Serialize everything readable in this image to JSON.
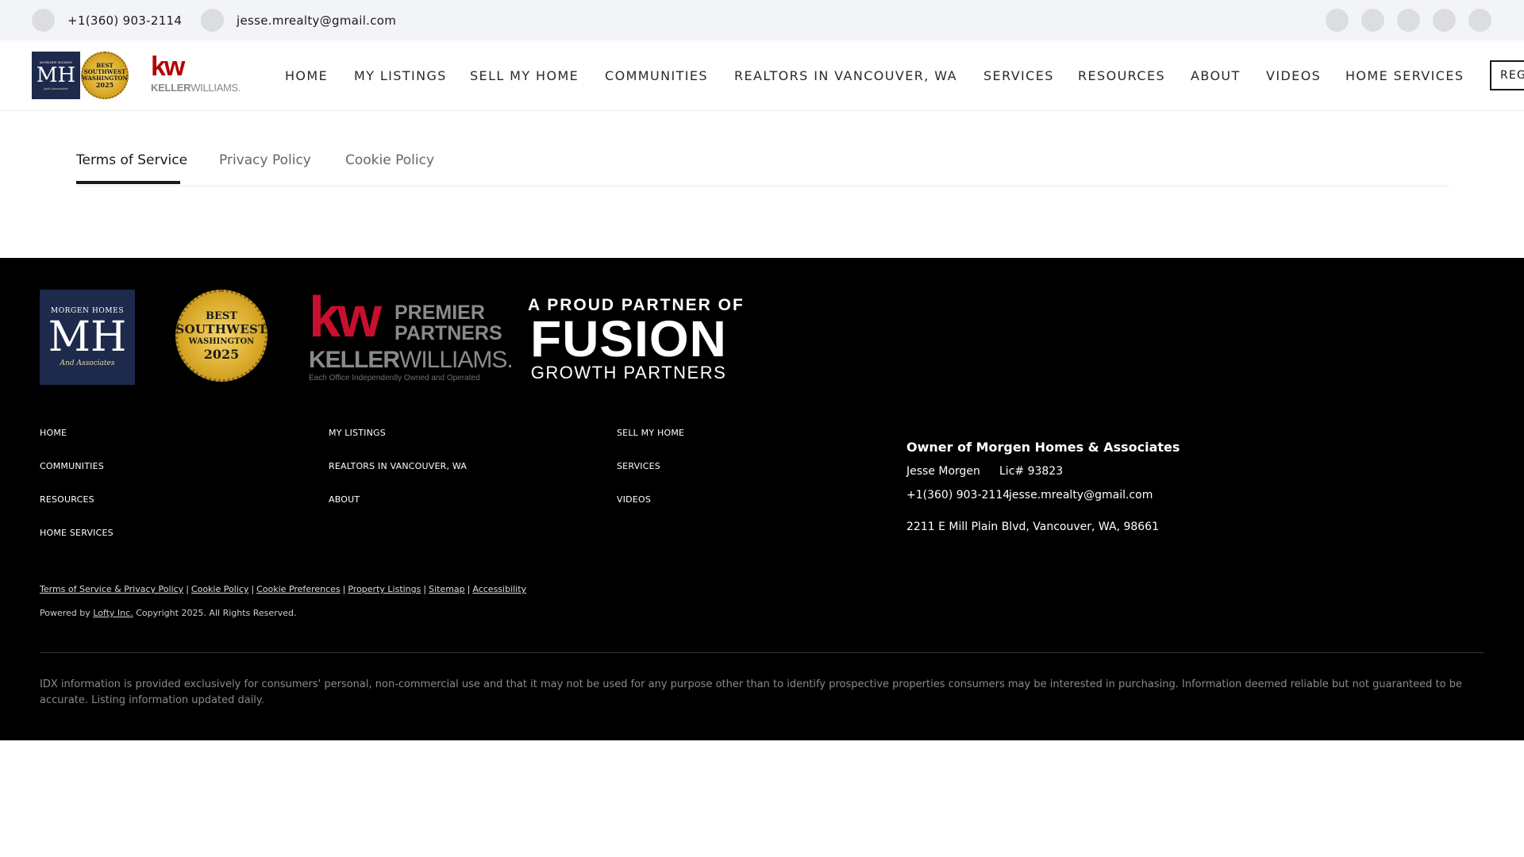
{
  "topbar": {
    "phone": "+1(360) 903-2114",
    "email": "jesse.mrealty@gmail.com",
    "social_icons": [
      "social-icon-1",
      "social-icon-2",
      "social-icon-3",
      "social-icon-4",
      "social-icon-5"
    ]
  },
  "header": {
    "logo_mh": {
      "top": "MORGEN HOMES",
      "mark": "MH",
      "sub": "And Associates"
    },
    "seal": {
      "line1": "BEST",
      "line2": "SOUTHWEST",
      "line3": "WASHINGTON",
      "year": "2025"
    },
    "kw_logo": {
      "mark": "kw",
      "word_bold": "KELLER",
      "word_light": "WILLIAMS."
    },
    "nav": [
      "HOME",
      "MY LISTINGS",
      "SELL MY HOME",
      "COMMUNITIES",
      "REALTORS IN VANCOUVER, WA",
      "SERVICES",
      "RESOURCES",
      "ABOUT",
      "VIDEOS",
      "HOME SERVICES"
    ],
    "cta_label": "REG"
  },
  "tabs": {
    "items": [
      "Terms of Service",
      "Privacy Policy",
      "Cookie Policy"
    ],
    "active": "Terms of Service"
  },
  "footer": {
    "logo_mh": {
      "top": "MORGEN HOMES",
      "mark": "MH",
      "sub": "And Associates"
    },
    "seal": {
      "line1": "BEST",
      "line2": "SOUTHWEST",
      "line3": "WASHINGTON",
      "year": "2025"
    },
    "kw_premier": {
      "mark": "kw",
      "premier1": "PREMIER",
      "premier2": "PARTNERS",
      "word_bold": "KELLER",
      "word_light": "WILLIAMS.",
      "small": "Each Office Independently Owned and Operated"
    },
    "fusion": {
      "line1": "A PROUD PARTNER OF",
      "line2": "FUSION",
      "line3": "GROWTH PARTNERS"
    },
    "links": {
      "col1": [
        "HOME",
        "COMMUNITIES",
        "RESOURCES",
        "HOME SERVICES"
      ],
      "col2": [
        "MY LISTINGS",
        "REALTORS IN VANCOUVER, WA",
        "ABOUT"
      ],
      "col3": [
        "SELL MY HOME",
        "SERVICES",
        "VIDEOS"
      ]
    },
    "owner": {
      "title": "Owner of Morgen Homes & Associates",
      "name": "Jesse Morgen",
      "license": "Lic# 93823",
      "phone": "+1(360) 903-2114",
      "email": "jesse.mrealty@gmail.com",
      "address": "2211 E Mill Plain Blvd, Vancouver, WA, 98661"
    },
    "legal_links": [
      "Terms of Service & Privacy Policy",
      "Cookie Policy",
      "Cookie Preferences",
      "Property Listings",
      "Sitemap",
      "Accessibility"
    ],
    "legal_separator": "|",
    "powered_prefix": "Powered by",
    "powered_link": "Lofty Inc.",
    "powered_suffix": "Copyright 2025. All Rights Reserved.",
    "idx_text": "IDX information is provided exclusively for consumers' personal, non-commercial use and that it may not be used for any purpose other than to identify prospective properties consumers may be interested in purchasing. Information deemed reliable but not guaranteed to be accurate. Listing information updated daily."
  },
  "colors": {
    "topbar_bg": "#f3f4f8",
    "footer_bg": "#000000",
    "mh_navy": "#1d2a4b",
    "kw_red": "#c8102e",
    "seal_gold": "#d9a929"
  }
}
